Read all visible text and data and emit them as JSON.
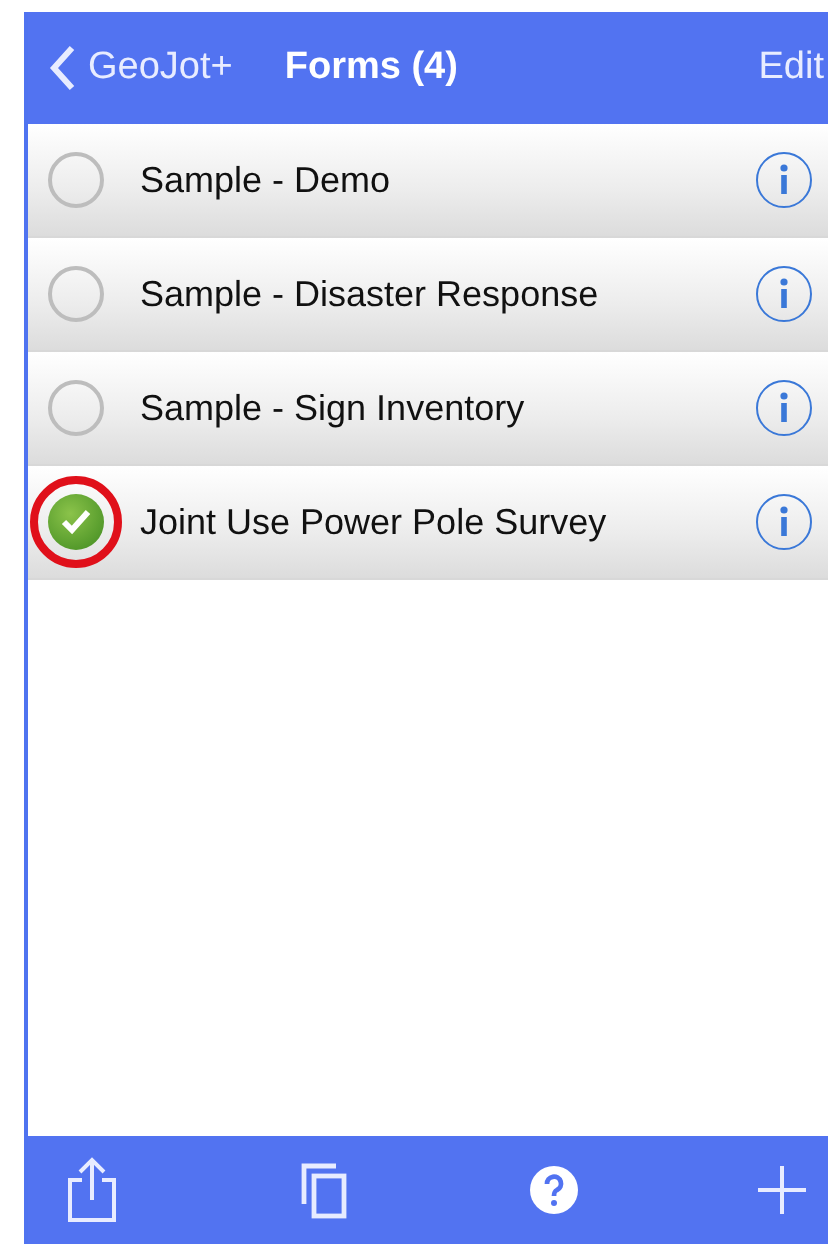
{
  "nav_bar": {
    "back_label": "GeoJot+",
    "title": "Forms (4)",
    "action": "Edit"
  },
  "forms": [
    {
      "name": "Sample - Demo",
      "selected": false,
      "annotated": false
    },
    {
      "name": "Sample - Disaster Response",
      "selected": false,
      "annotated": false
    },
    {
      "name": "Sample - Sign Inventory",
      "selected": false,
      "annotated": false
    },
    {
      "name": "Joint Use Power Pole Survey",
      "selected": true,
      "annotated": true
    }
  ],
  "toolbar": [
    {
      "kind": "share"
    },
    {
      "kind": "copy"
    },
    {
      "kind": "help"
    },
    {
      "kind": "add"
    }
  ]
}
